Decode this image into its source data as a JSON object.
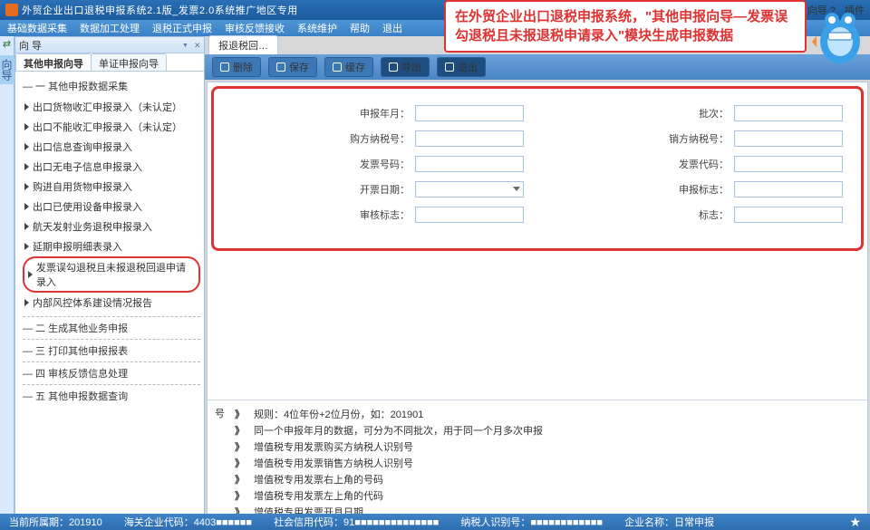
{
  "title": "外贸企业出口退税申报系统2.1版_发票2.0系统推广地区专用",
  "titlebar_right": [
    "向导 ?",
    "插件"
  ],
  "menubar": [
    "基础数据采集",
    "数据加工处理",
    "退税正式申报",
    "审核反馈接收",
    "系统维护",
    "帮助",
    "退出"
  ],
  "siderail_label": "向导",
  "panel": {
    "title": "向 导",
    "close_glyph": "▾ ✕",
    "tabs": [
      "其他申报向导",
      "单证申报向导"
    ],
    "active_tab": 0,
    "group1": "— 一 其他申报数据采集",
    "items": [
      "出口货物收汇申报录入（未认定）",
      "出口不能收汇申报录入（未认定）",
      "出口信息查询申报录入",
      "出口无电子信息申报录入",
      "购进自用货物申报录入",
      "出口已使用设备申报录入",
      "航天发射业务退税申报录入",
      "延期申报明细表录入",
      "发票误勾退税且未报退税回退申请录入",
      "内部风控体系建设情况报告"
    ],
    "highlight_index": 8,
    "sections": [
      "— 二 生成其他业务申报",
      "— 三 打印其他申报报表",
      "— 四 审核反馈信息处理",
      "— 五 其他申报数据查询"
    ]
  },
  "doc_tab": "报退税回…",
  "toolbar": [
    {
      "icon": "trash",
      "label": "删除"
    },
    {
      "icon": "save",
      "label": "保存"
    },
    {
      "icon": "ram",
      "label": "缓存"
    },
    {
      "icon": "export",
      "label": "导出",
      "dark": true
    },
    {
      "icon": "exit",
      "label": "退出",
      "dark": true
    }
  ],
  "form": {
    "left": [
      {
        "label": "申报年月：",
        "type": "text"
      },
      {
        "label": "购方纳税号：",
        "type": "text"
      },
      {
        "label": "发票号码：",
        "type": "text"
      },
      {
        "label": "开票日期：",
        "type": "select"
      },
      {
        "label": "审核标志：",
        "type": "text"
      }
    ],
    "right": [
      {
        "label": "批次：",
        "type": "text"
      },
      {
        "label": "销方纳税号：",
        "type": "text"
      },
      {
        "label": "发票代码：",
        "type": "text"
      },
      {
        "label": "申报标志：",
        "type": "text"
      },
      {
        "label": "标志：",
        "type": "text"
      }
    ]
  },
  "rules_left_label": "号",
  "rules": [
    "规则：4位年份+2位月份，如：201901",
    "同一个申报年月的数据，可分为不同批次，用于同一个月多次申报",
    "增值税专用发票购买方纳税人识别号",
    "增值税专用发票销售方纳税人识别号",
    "增值税专用发票右上角的号码",
    "增值税专用发票左上角的代码",
    "增值税专用发票开具日期"
  ],
  "callout": "在外贸企业出口退税申报系统，\"其他申报向导—发票误勾退税且未报退税申请录入\"模块生成申报数据",
  "statusbar": {
    "period": "当前所属期：201910",
    "customs": "海关企业代码：4403■■■■■■",
    "credit": "社会信用代码：91■■■■■■■■■■■■■■",
    "tax": "纳税人识别号：■■■■■■■■■■■■",
    "name": "企业名称：日常申报"
  }
}
